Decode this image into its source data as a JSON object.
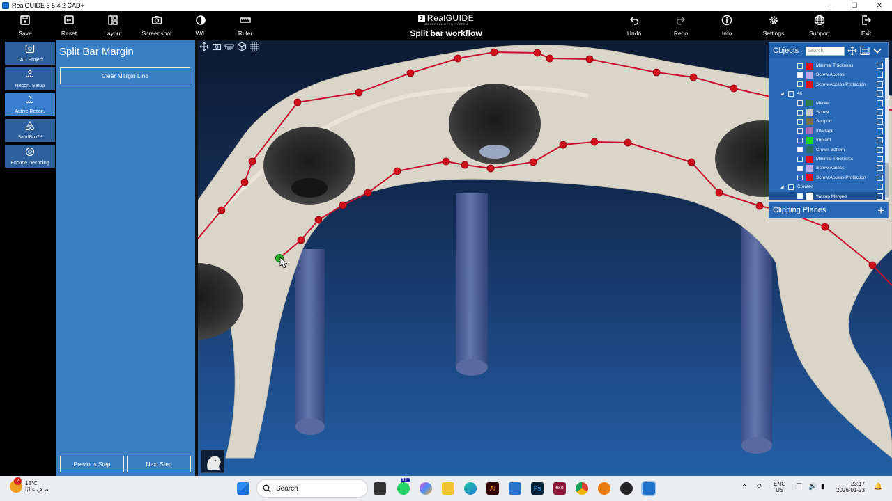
{
  "window": {
    "title": "RealGUIDE 5  5.4.2  CAD+"
  },
  "toolbar": {
    "left": [
      {
        "label": "Save",
        "icon": "save-icon"
      },
      {
        "label": "Reset",
        "icon": "reset-icon"
      },
      {
        "label": "Layout",
        "icon": "layout-icon"
      },
      {
        "label": "Screenshot",
        "icon": "camera-icon"
      },
      {
        "label": "W/L",
        "icon": "contrast-icon"
      },
      {
        "label": "Ruler",
        "icon": "ruler-icon"
      }
    ],
    "brand": "RealGUIDE",
    "brand_sub": "UNIVERSAL OPEN SYSTEM",
    "workflow_title": "Split bar workflow",
    "right": [
      {
        "label": "Undo",
        "icon": "undo-icon"
      },
      {
        "label": "Redo",
        "icon": "redo-icon"
      },
      {
        "label": "Info",
        "icon": "info-icon"
      },
      {
        "label": "Settings",
        "icon": "gear-icon"
      },
      {
        "label": "Support",
        "icon": "globe-icon"
      },
      {
        "label": "Exit",
        "icon": "exit-icon"
      }
    ]
  },
  "leftnav": [
    {
      "label": "CAD Project",
      "icon": "cad-project-icon"
    },
    {
      "label": "Recon. Setup",
      "icon": "recon-setup-icon"
    },
    {
      "label": "Active Recon.",
      "icon": "active-recon-icon"
    },
    {
      "label": "SandBox™",
      "icon": "sandbox-icon"
    },
    {
      "label": "Encode Decoding",
      "icon": "encode-decoding-icon"
    }
  ],
  "panel": {
    "title": "Split Bar Margin",
    "clear_label": "Clear Margin Line",
    "prev_label": "Previous Step",
    "next_label": "Next Step"
  },
  "objects": {
    "title": "Objects",
    "search_placeholder": "Search",
    "rows": [
      {
        "name": "Minimal Thickness",
        "color": "#e0101a",
        "checked": false
      },
      {
        "name": "Screw Access",
        "color": "#b8a8e8",
        "checked": true
      },
      {
        "name": "Screw Access Protection",
        "color": "#e0101a",
        "checked": false
      },
      {
        "name": "46",
        "group": true
      },
      {
        "name": "Marker",
        "color": "#2e7a4a",
        "checked": false
      },
      {
        "name": "Screw",
        "color": "#c8c8c8",
        "checked": false
      },
      {
        "name": "Support",
        "color": "#7d7048",
        "checked": false
      },
      {
        "name": "Interface",
        "color": "#b06ab8",
        "checked": false
      },
      {
        "name": "Implant",
        "color": "#18d820",
        "checked": false
      },
      {
        "name": "Crown Bottom",
        "color": "#2a6e5e",
        "checked": true
      },
      {
        "name": "Minimal Thickness",
        "color": "#e0101a",
        "checked": false
      },
      {
        "name": "Screw Access",
        "color": "#b8a8e8",
        "checked": true
      },
      {
        "name": "Screw Access Protection",
        "color": "#e0101a",
        "checked": false
      },
      {
        "name": "Created",
        "group": true
      },
      {
        "name": "Waxup Merged",
        "color": "#ffffff",
        "checked": true,
        "selected": true
      }
    ]
  },
  "clipping": {
    "title": "Clipping Planes"
  },
  "taskbar": {
    "temp": "15°C",
    "weather_text": "صافٍ غالبًا",
    "weather_badge": "2",
    "search_label": "Search",
    "whatsapp_badge": "99+",
    "lang": "ENG",
    "region": "US",
    "time": "23:17",
    "date": "2026-01-23"
  }
}
